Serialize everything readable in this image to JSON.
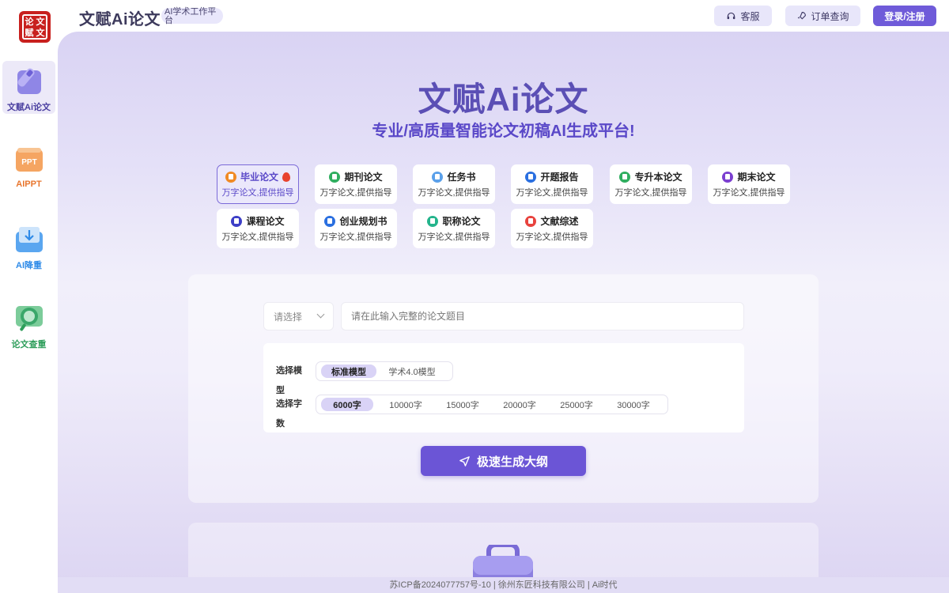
{
  "header": {
    "logo_chars": [
      "文",
      "论",
      "赋",
      "文"
    ],
    "brand_title": "文赋Ai论文",
    "brand_tag": "AI学术工作平台",
    "service_label": "客服",
    "order_label": "订单查询",
    "login_label": "登录/注册"
  },
  "sidebar": {
    "items": [
      {
        "label": "文赋Ai论文",
        "icon": "pen-icon",
        "color": "#4a3fa0"
      },
      {
        "label": "AIPPT",
        "icon": "ppt-icon",
        "color": "#e8762e"
      },
      {
        "label": "AI降重",
        "icon": "download-icon",
        "color": "#2f8be8"
      },
      {
        "label": "论文查重",
        "icon": "magnifier-icon",
        "color": "#2e9e5b"
      }
    ]
  },
  "hero": {
    "title": "文赋Ai论文",
    "subtitle": "专业/高质量智能论文初稿AI生成平台!"
  },
  "paper_types": [
    {
      "title": "毕业论文",
      "sub": "万字论文,提供指导",
      "icon_color": "#f08a24",
      "hot": true
    },
    {
      "title": "期刊论文",
      "sub": "万字论文,提供指导",
      "icon_color": "#2fae5f"
    },
    {
      "title": "任务书",
      "sub": "万字论文,提供指导",
      "icon_color": "#5aa0ea"
    },
    {
      "title": "开题报告",
      "sub": "万字论文,提供指导",
      "icon_color": "#2a6fe0"
    },
    {
      "title": "专升本论文",
      "sub": "万字论文,提供指导",
      "icon_color": "#2fae5f"
    },
    {
      "title": "期末论文",
      "sub": "万字论文,提供指导",
      "icon_color": "#7b3fd0"
    },
    {
      "title": "课程论文",
      "sub": "万字论文,提供指导",
      "icon_color": "#3d3fc7"
    },
    {
      "title": "创业规划书",
      "sub": "万字论文,提供指导",
      "icon_color": "#2a6fe0"
    },
    {
      "title": "职称论文",
      "sub": "万字论文,提供指导",
      "icon_color": "#24b48c"
    },
    {
      "title": "文献综述",
      "sub": "万字论文,提供指导",
      "icon_color": "#e8433e"
    }
  ],
  "form": {
    "select_placeholder": "请选择",
    "topic_placeholder": "请在此输入完整的论文题目",
    "model_label": "选择模型",
    "models": [
      "标准模型",
      "学术4.0模型"
    ],
    "selected_model": "标准模型",
    "words_label": "选择字数",
    "word_counts": [
      "6000字",
      "10000字",
      "15000字",
      "20000字",
      "25000字",
      "30000字"
    ],
    "selected_words": "6000字",
    "generate_label": "极速生成大纲"
  },
  "footer": {
    "text": "苏ICP备2024077757号-10 | 徐州东匠科技有限公司 | Ai时代"
  }
}
